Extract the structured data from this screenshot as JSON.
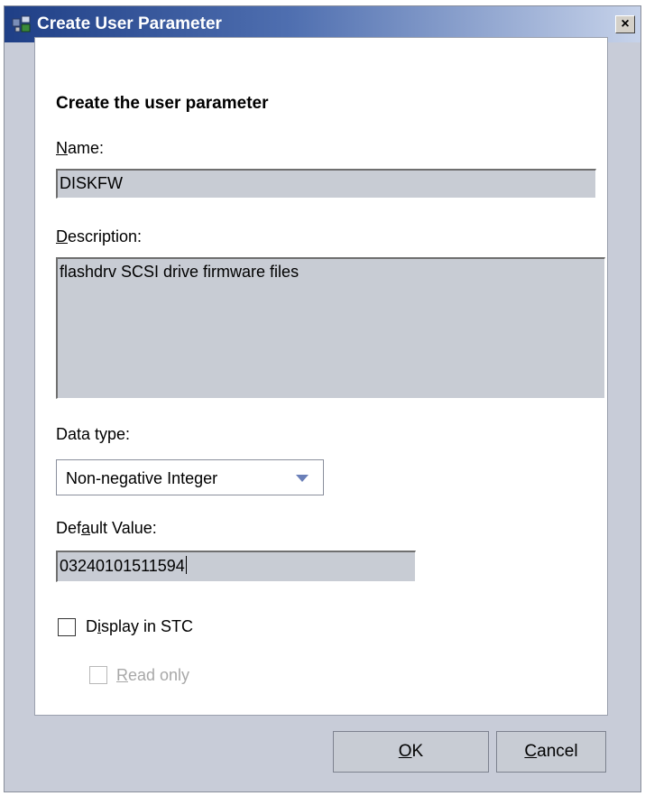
{
  "window": {
    "title": "Create User Parameter",
    "close_label": "×",
    "app_icon": "app-window-icon"
  },
  "form": {
    "heading": "Create the user parameter",
    "name": {
      "label_first": "N",
      "label_rest": "ame:",
      "value": "DISKFW"
    },
    "description": {
      "label_first": "D",
      "label_rest": "escription:",
      "value": "flashdrv SCSI drive firmware files"
    },
    "data_type": {
      "label": "Data type:",
      "selected": "Non-negative Integer"
    },
    "default_value": {
      "label_pre": "Def",
      "label_mnemonic": "a",
      "label_post": "ult Value:",
      "value": "03240101511594"
    },
    "display_in_stc": {
      "label_pre": "D",
      "label_mnemonic": "i",
      "label_post": "splay in STC",
      "checked": false
    },
    "read_only": {
      "label_mnemonic": "R",
      "label_post": "ead only",
      "checked": false,
      "enabled": false
    }
  },
  "buttons": {
    "ok_mnemonic": "O",
    "ok_rest": "K",
    "cancel_mnemonic": "C",
    "cancel_rest": "ancel"
  },
  "colors": {
    "title_gradient_start": "#1f3f86",
    "title_gradient_end": "#c7d3ea",
    "dialog_bg": "#c8ccd8",
    "field_bg": "#c8ccd4"
  }
}
